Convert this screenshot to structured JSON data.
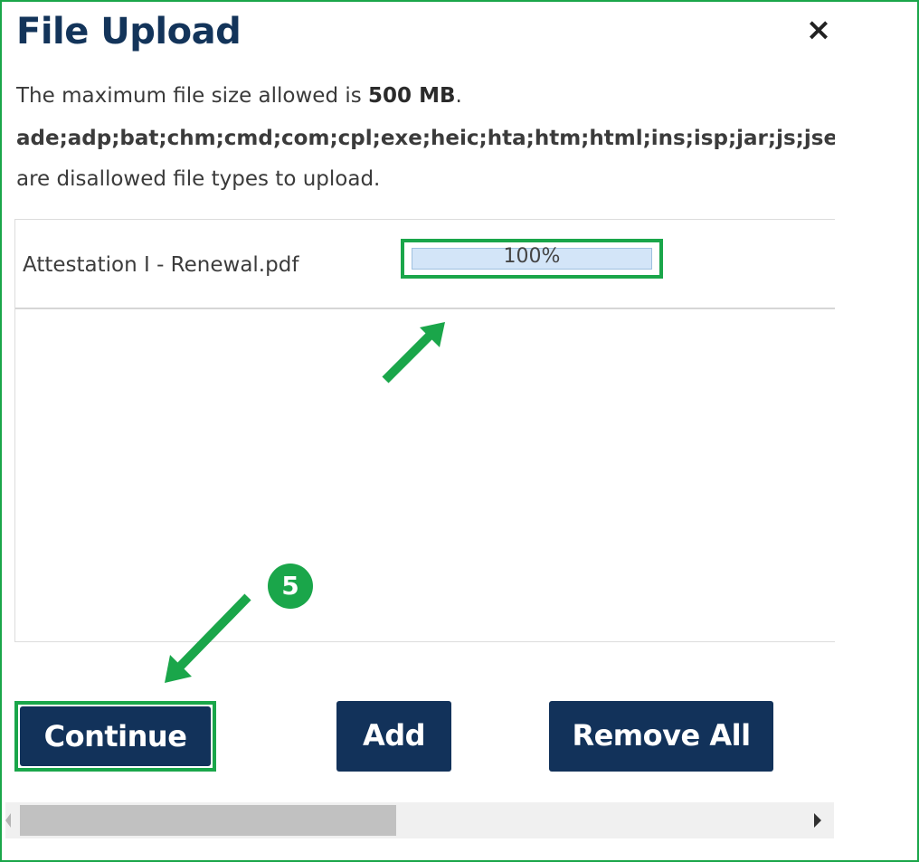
{
  "dialog": {
    "title": "File Upload",
    "close_glyph": "×",
    "max_size_prefix": "The maximum file size allowed is ",
    "max_size_value": "500 MB",
    "max_size_suffix": ".",
    "disallowed_types": "ade;adp;bat;chm;cmd;com;cpl;exe;heic;hta;htm;html;ins;isp;jar;js;jse;lib;lnk;mde;msc;msp;mst;pif;scr;sct;shb;sys;vb;vbe;vbs;vxd;wsc;wsf;wsh",
    "disallowed_suffix": "are disallowed file types to upload."
  },
  "files": [
    {
      "name": "Attestation I - Renewal.pdf",
      "progress_text": "100%",
      "progress": 1.0
    }
  ],
  "buttons": {
    "continue": "Continue",
    "add": "Add",
    "remove_all": "Remove All"
  },
  "annotations": {
    "step_badge": "5",
    "accent_color": "#1aa64a"
  },
  "colors": {
    "title": "#13345a",
    "button_bg": "#12325a",
    "progress_bg": "#dceaf7"
  },
  "scrollbar": {
    "scroll_fraction": 0.45
  }
}
